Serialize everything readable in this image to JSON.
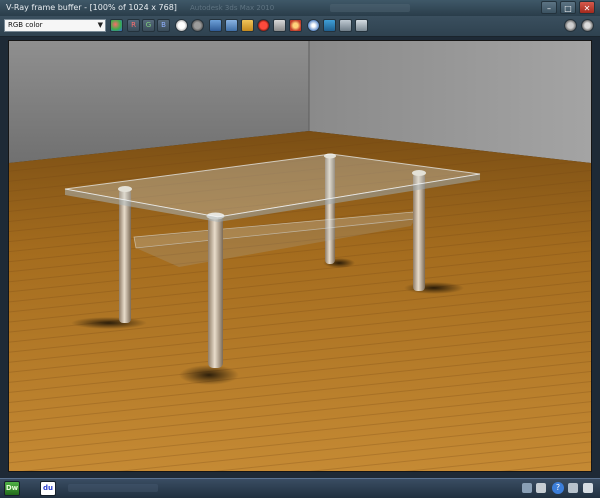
{
  "window": {
    "title": "V-Ray frame buffer - [100% of 1024 x 768]",
    "title_ghost": "Autodesk 3ds Max 2010"
  },
  "toolbar": {
    "channel_value": "RGB color",
    "channel_button_r": "R",
    "channel_button_g": "G",
    "channel_button_b": "B"
  },
  "colors": {
    "titlebar": "#2f4452",
    "floor_mid": "#b27a24",
    "wall": "#8a8a8a",
    "taskbar": "#2a3b4c"
  },
  "taskbar": {
    "dreamweaver_label": "Dw",
    "baidu_label": "du"
  },
  "icons": [
    "tracking-mouse-icon",
    "rgb-channel-icon",
    "mono-view-icon",
    "alpha-circle-icon",
    "save-image-icon",
    "duplicate-icon",
    "open-folder-icon",
    "record-icon",
    "region-render-icon",
    "link-icon",
    "lens-effects-icon",
    "color-correction-icon",
    "curves-icon",
    "histogram-icon",
    "settings-icon",
    "help-icon"
  ]
}
